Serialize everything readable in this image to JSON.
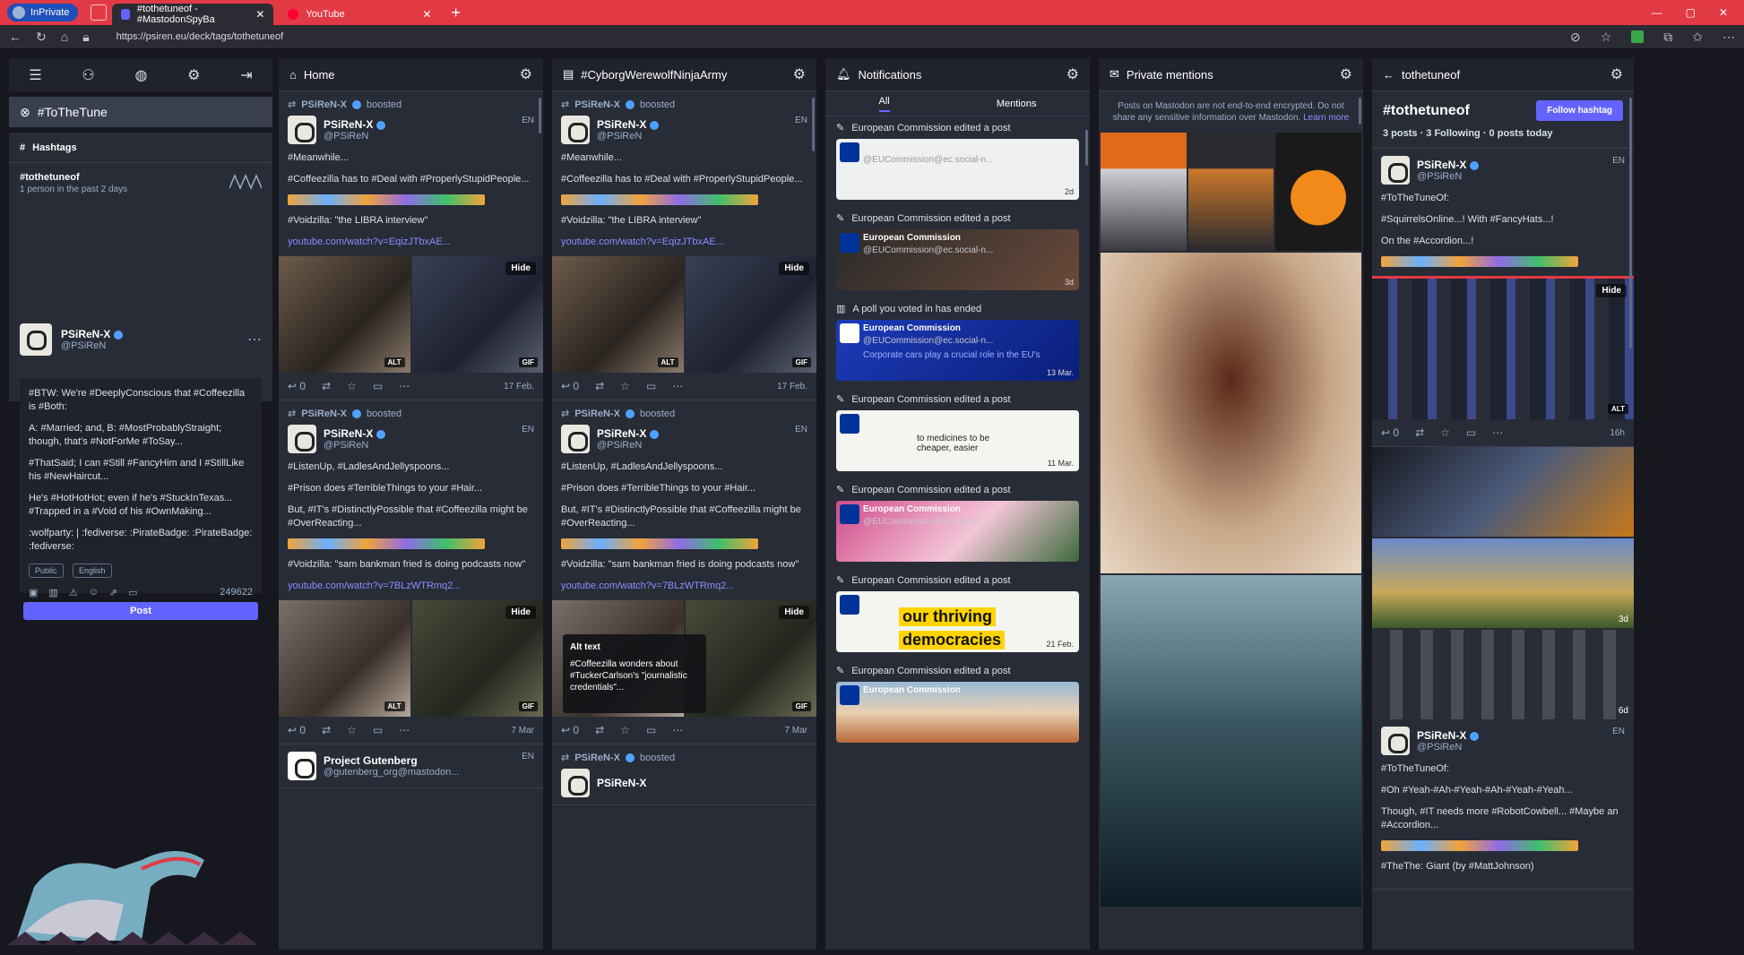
{
  "browser": {
    "inprivate_label": "InPrivate",
    "tabs": [
      {
        "label": "#tothetuneof - #MastodonSpyBa",
        "active": true
      },
      {
        "label": "YouTube",
        "active": false
      }
    ],
    "url": "https://psiren.eu/deck/tags/tothetuneof"
  },
  "sidebar": {
    "active_hashtag": "#ToTheTune",
    "hashtags_header": "Hashtags",
    "hashtag_name": "#tothetuneof",
    "hashtag_usage": "1 person in the past 2 days",
    "composer": {
      "name": "PSiReN-X",
      "handle": "@PSiReN",
      "text": [
        "#BTW: We're #DeeplyConscious that #Coffeezilla is #Both:",
        "A: #Married; and, B: #MostProbablyStraight; though, that's #NotForMe #ToSay...",
        "#ThatSaid; I can #Still #FancyHim and I #StillLike his #NewHaircut...",
        "He's #HotHotHot; even if he's #StuckInTexas... #Trapped in a #Void of his #OwnMaking...",
        ":wolfparty: | :fediverse: :PirateBadge: :PirateBadge: :fediverse:"
      ],
      "visibility": "Public",
      "language": "English",
      "char_count": "249622",
      "post_label": "Post"
    }
  },
  "columns": [
    {
      "title": "Home",
      "posts": [
        {
          "boost": "PSiReN-X",
          "boosted": "boosted",
          "name": "PSiReN-X",
          "handle": "@PSiReN",
          "meta": "EN",
          "text": [
            "#Meanwhile...",
            "#Coffeezilla has to #Deal with #ProperlyStupidPeople...",
            "#Voidzilla: \"the LIBRA interview\""
          ],
          "link": "youtube.com/watch?v=EqizJTbxAE...",
          "replies": "0",
          "time": "17 Feb."
        },
        {
          "boost": "PSiReN-X",
          "boosted": "boosted",
          "name": "PSiReN-X",
          "handle": "@PSiReN",
          "meta": "EN",
          "text": [
            "#ListenUp, #LadlesAndJellyspoons...",
            "#Prison does #TerribleThings to your #Hair...",
            "But, #IT's #DistinctlyPossible that #Coffeezilla might be #OverReacting...",
            "#Voidzilla: \"sam bankman fried is doing podcasts now\""
          ],
          "link": "youtube.com/watch?v=7BLzWTRmq2...",
          "replies": "0",
          "time": "7 Mar"
        },
        {
          "name": "Project Gutenberg",
          "handle": "@gutenberg_org@mastodon...",
          "meta": "EN"
        }
      ]
    },
    {
      "title": "#CyborgWerewolfNinjaArmy",
      "alt_text_title": "Alt text",
      "alt_text_body": "#Coffeezilla wonders about #TuckerCarlson's \"journalistic credentials\"...",
      "last_boost": "PSiReN-X",
      "last_name": "PSiReN-X"
    },
    {
      "title": "Notifications",
      "tabs": [
        "All",
        "Mentions"
      ],
      "items": [
        {
          "title": "European Commission edited a post",
          "time": "2d"
        },
        {
          "title": "European Commission edited a post",
          "time": "3d"
        },
        {
          "title": "A poll you voted in has ended",
          "time": "13 Mar."
        },
        {
          "title": "European Commission edited a post",
          "time": "11 Mar."
        },
        {
          "title": "European Commission edited a post",
          "time": ""
        },
        {
          "title": "European Commission edited a post",
          "time": "21 Feb."
        },
        {
          "title": "European Commission edited a post",
          "time": ""
        }
      ],
      "card_name": "European Commission",
      "card_handle": "@EUCommission@ec.social-n...",
      "card_poll_text": "Corporate cars play a crucial role in the EU's",
      "card_medicine_text": "to medicines to be cheaper, easier",
      "card_thriving": "our thriving",
      "card_democracies": "democracies"
    },
    {
      "title": "Private mentions",
      "note": "Posts on Mastodon are not end-to-end encrypted. Do not share any sensitive information over Mastodon.",
      "learn_more": "Learn more"
    },
    {
      "title": "tothetuneof",
      "hashtag": "#tothetuneof",
      "follow_label": "Follow hashtag",
      "stats": "3 posts · 3 Following · 0 posts today",
      "posts": [
        {
          "name": "PSiReN-X",
          "handle": "@PSiReN",
          "meta": "EN",
          "text": [
            "#ToTheTuneOf:",
            "#SquirrelsOnline...! With #FancyHats...!",
            "On the #Accordion...!"
          ],
          "replies": "0",
          "time": "16h"
        },
        {
          "name": "PSiReN-X",
          "handle": "@PSiReN",
          "meta": "EN",
          "text": [
            "#ToTheTuneOf:",
            "#Oh #Yeah-#Ah-#Yeah-#Ah-#Yeah-#Yeah...",
            "Though, #IT needs more #RobotCowbell... #Maybe an #Accordion...",
            "#TheThe: Giant (by #MattJohnson)"
          ]
        }
      ],
      "time_3d": "3d",
      "time_6d": "6d"
    }
  ],
  "colors": {
    "accent": "#6364ff",
    "bg": "#17171f",
    "column": "#282c37",
    "header": "#20232c",
    "tabbar": "#e23a44"
  }
}
